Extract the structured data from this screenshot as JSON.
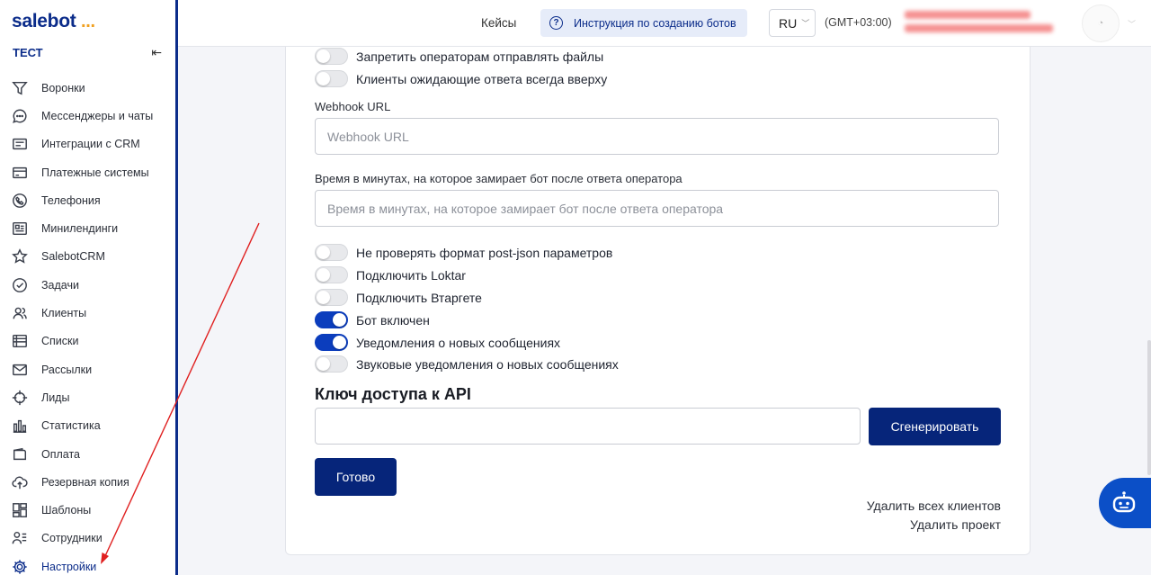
{
  "brand": {
    "name": "salebot",
    "dots": "..."
  },
  "sidebar": {
    "project": "ТЕСТ",
    "collapse_icon": "collapse-left-icon",
    "items": [
      {
        "label": "Воронки",
        "icon": "funnel-icon"
      },
      {
        "label": "Мессенджеры и чаты",
        "icon": "chat-bubble-icon"
      },
      {
        "label": "Интеграции с CRM",
        "icon": "crm-icon"
      },
      {
        "label": "Платежные системы",
        "icon": "card-icon"
      },
      {
        "label": "Телефония",
        "icon": "phone-icon"
      },
      {
        "label": "Минилендинги",
        "icon": "landing-icon"
      },
      {
        "label": "SalebotCRM",
        "icon": "star-icon"
      },
      {
        "label": "Задачи",
        "icon": "check-circle-icon"
      },
      {
        "label": "Клиенты",
        "icon": "users-icon"
      },
      {
        "label": "Списки",
        "icon": "list-icon"
      },
      {
        "label": "Рассылки",
        "icon": "mail-icon"
      },
      {
        "label": "Лиды",
        "icon": "target-icon"
      },
      {
        "label": "Статистика",
        "icon": "bar-chart-icon"
      },
      {
        "label": "Оплата",
        "icon": "wallet-icon"
      },
      {
        "label": "Резервная копия",
        "icon": "cloud-upload-icon"
      },
      {
        "label": "Шаблоны",
        "icon": "grid-icon"
      },
      {
        "label": "Сотрудники",
        "icon": "staff-icon"
      },
      {
        "label": "Настройки",
        "icon": "gear-icon",
        "active": true
      }
    ]
  },
  "header": {
    "cases": "Кейсы",
    "guide": "Инструкция по созданию ботов",
    "lang": "RU",
    "timezone": "(GMT+03:00)"
  },
  "settings": {
    "toggles_top": [
      {
        "label": "Запретить операторам отправлять файлы",
        "on": false
      },
      {
        "label": "Клиенты ожидающие ответа всегда вверху",
        "on": false
      }
    ],
    "webhook": {
      "label": "Webhook URL",
      "placeholder": "Webhook URL",
      "value": ""
    },
    "freeze": {
      "label": "Время в минутах, на которое замирает бот после ответа оператора",
      "placeholder": "Время в минутах, на которое замирает бот после ответа оператора",
      "value": ""
    },
    "toggles_bottom": [
      {
        "label": "Не проверять формат post-json параметров",
        "on": false
      },
      {
        "label": "Подключить Loktar",
        "on": false
      },
      {
        "label": "Подключить Втаргете",
        "on": false
      },
      {
        "label": "Бот включен",
        "on": true
      },
      {
        "label": "Уведомления о новых сообщениях",
        "on": true
      },
      {
        "label": "Звуковые уведомления о новых сообщениях",
        "on": false
      }
    ],
    "api": {
      "title": "Ключ доступа к API",
      "value": "",
      "generate_label": "Сгенерировать"
    },
    "done_label": "Готово",
    "delete_clients": "Удалить всех клиентов",
    "delete_project": "Удалить проект"
  },
  "colors": {
    "brand": "#0b2c8a",
    "accent": "#f0a020",
    "toggle_on": "#0b3dbd",
    "button": "#06257a",
    "annotation": "#e02020"
  }
}
